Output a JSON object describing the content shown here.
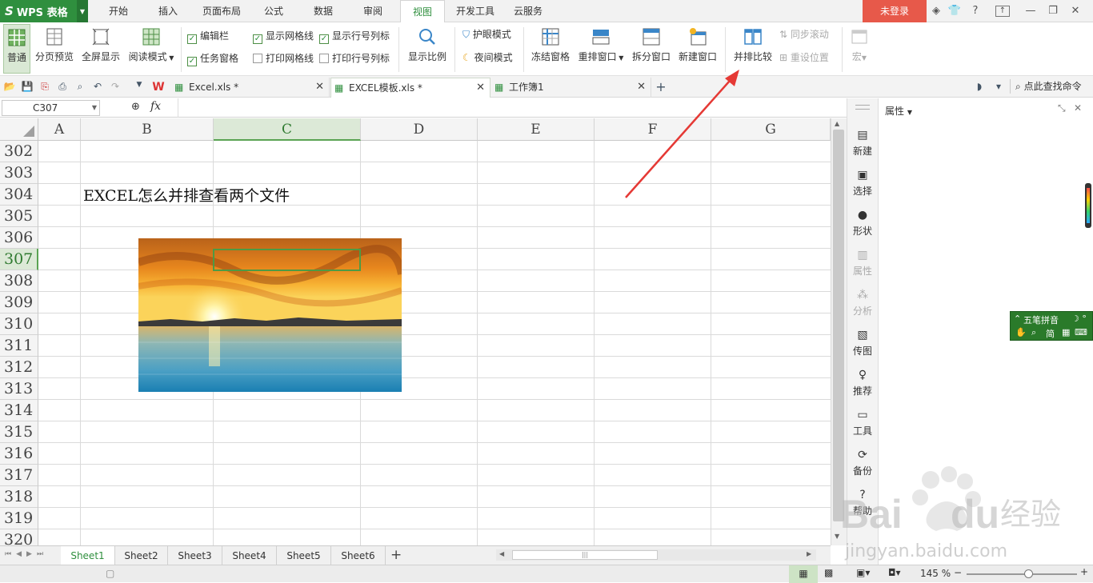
{
  "app": {
    "brand_logo": "S",
    "brand_name": "WPS 表格",
    "login_label": "未登录",
    "window_help": "?"
  },
  "menu_tabs": [
    "开始",
    "插入",
    "页面布局",
    "公式",
    "数据",
    "审阅",
    "视图",
    "开发工具",
    "云服务"
  ],
  "active_menu_tab": "视图",
  "ribbon": {
    "view_normal": "普通",
    "view_page_break": "分页预览",
    "view_fullscreen": "全屏显示",
    "view_reading": "阅读模式",
    "cb_edit_bar": "编辑栏",
    "cb_task_pane": "任务窗格",
    "cb_show_gridlines": "显示网格线",
    "cb_print_gridlines": "打印网格线",
    "cb_show_headings": "显示行号列标",
    "cb_print_headings": "打印行号列标",
    "zoom": "显示比例",
    "eye_mode": "护眼模式",
    "night_mode": "夜间模式",
    "freeze": "冻结窗格",
    "arrange": "重排窗口",
    "split": "拆分窗口",
    "new_window": "新建窗口",
    "side_by_side": "并排比较",
    "sync_scroll": "同步滚动",
    "reset_position": "重设位置",
    "macro": "宏"
  },
  "doc_tabs": [
    {
      "label": "Excel.xls *",
      "icon": "spreadsheet-icon"
    },
    {
      "label": "EXCEL模板.xls *",
      "icon": "spreadsheet-icon"
    },
    {
      "label": "工作簿1",
      "icon": "spreadsheet-icon"
    }
  ],
  "search_cmd": "点此查找命令",
  "formula_bar": {
    "name_box": "C307",
    "fx": "fx",
    "value": ""
  },
  "columns": [
    "A",
    "B",
    "C",
    "D",
    "E",
    "F",
    "G"
  ],
  "selected_column": "C",
  "rows": [
    "302",
    "303",
    "304",
    "305",
    "306",
    "307",
    "308",
    "309",
    "310",
    "311",
    "312",
    "313",
    "314",
    "315",
    "316",
    "317",
    "318",
    "319",
    "320"
  ],
  "selected_row": "307",
  "cell_text": "EXCEL怎么并排查看两个文件",
  "sheets": [
    "Sheet1",
    "Sheet2",
    "Sheet3",
    "Sheet4",
    "Sheet5",
    "Sheet6"
  ],
  "active_sheet": "Sheet1",
  "add_sheet": "+",
  "status": {
    "zoom": "145 %"
  },
  "side_panel": {
    "title": "属性",
    "items": [
      {
        "label": "新建",
        "dim": false
      },
      {
        "label": "选择",
        "dim": false
      },
      {
        "label": "形状",
        "dim": false
      },
      {
        "label": "属性",
        "dim": true
      },
      {
        "label": "分析",
        "dim": true
      },
      {
        "label": "传图",
        "dim": false
      },
      {
        "label": "推荐",
        "dim": false
      },
      {
        "label": "工具",
        "dim": false
      },
      {
        "label": "备份",
        "dim": false
      },
      {
        "label": "帮助",
        "dim": false
      }
    ]
  },
  "ime": {
    "name": "五笔拼音",
    "mode": "简"
  },
  "watermark": {
    "brand": "Bai",
    "brand2": "du",
    "suffix": "经验",
    "url": "jingyan.baidu.com"
  },
  "colors": {
    "wps_green": "#2f8f3e",
    "login_red": "#e7594a",
    "annotation_red": "#e53935",
    "ime_green": "#2a7a2a"
  }
}
